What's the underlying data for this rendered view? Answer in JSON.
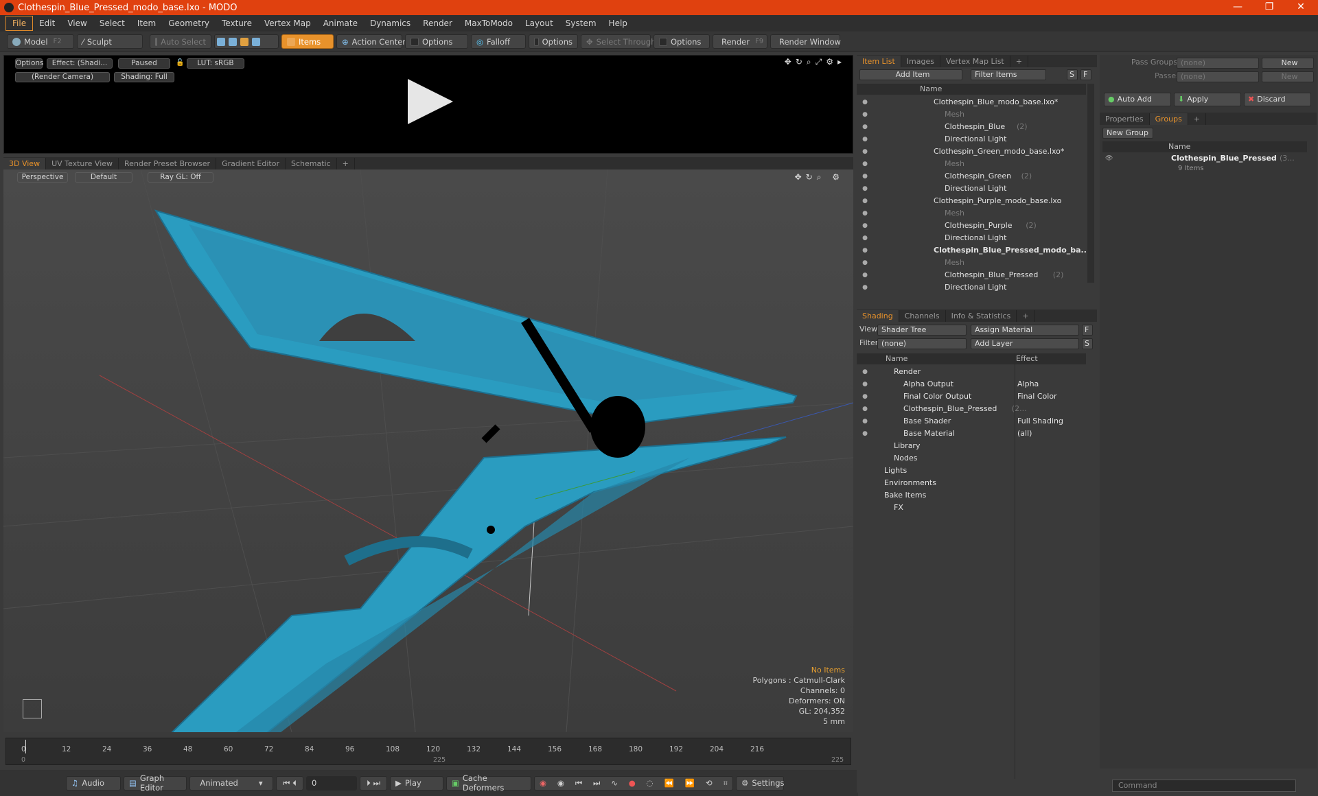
{
  "window": {
    "title": "Clothespin_Blue_Pressed_modo_base.lxo - MODO"
  },
  "menu": [
    "File",
    "Edit",
    "View",
    "Select",
    "Item",
    "Geometry",
    "Texture",
    "Vertex Map",
    "Animate",
    "Dynamics",
    "Render",
    "MaxToModo",
    "Layout",
    "System",
    "Help"
  ],
  "toolbar": {
    "model": "Model",
    "model_key": "F2",
    "sculpt": "Sculpt",
    "auto_select": "Auto Select",
    "items": "Items",
    "action_center": "Action Center",
    "options1": "Options",
    "falloff": "Falloff",
    "options2": "Options",
    "select_through": "Select Through",
    "options3": "Options",
    "render": "Render",
    "render_key": "F9",
    "render_window": "Render Window"
  },
  "preview": {
    "options": "Options",
    "effect": "Effect: (Shadi...",
    "paused": "Paused",
    "lut": "LUT: sRGB",
    "camera": "(Render Camera)",
    "shading": "Shading: Full"
  },
  "viewport_tabs": [
    "3D View",
    "UV Texture View",
    "Render Preset Browser",
    "Gradient Editor",
    "Schematic",
    "+"
  ],
  "viewport": {
    "projection": "Perspective",
    "style": "Default",
    "raygl": "Ray GL: Off"
  },
  "stats": {
    "selection": "No Items",
    "polygons": "Polygons : Catmull-Clark",
    "channels": "Channels: 0",
    "deformers": "Deformers: ON",
    "gl": "GL: 204,352",
    "scale": "5 mm"
  },
  "timeline": {
    "ticks": [
      "0",
      "12",
      "24",
      "36",
      "48",
      "60",
      "72",
      "84",
      "96",
      "108",
      "120",
      "132",
      "144",
      "156",
      "168",
      "180",
      "192",
      "204",
      "216"
    ],
    "sub_ticks": [
      "0",
      "225",
      "225"
    ]
  },
  "bottombar": {
    "audio": "Audio",
    "graph_editor": "Graph Editor",
    "animated": "Animated",
    "frame": "0",
    "play": "Play",
    "cache": "Cache Deformers",
    "settings": "Settings"
  },
  "itemlist": {
    "tabs": [
      "Item List",
      "Images",
      "Vertex Map List",
      "+"
    ],
    "add_item": "Add Item",
    "filter": "Filter Items",
    "s": "S",
    "f": "F",
    "col_name": "Name",
    "rows": [
      {
        "label": "Clothespin_Blue_modo_base.lxo*",
        "indent": 1,
        "kind": "scene",
        "dim": false,
        "count": ""
      },
      {
        "label": "Mesh",
        "indent": 2,
        "kind": "mesh",
        "dim": true,
        "count": ""
      },
      {
        "label": "Clothespin_Blue",
        "indent": 2,
        "kind": "group",
        "dim": false,
        "count": "(2)"
      },
      {
        "label": "Directional Light",
        "indent": 2,
        "kind": "light",
        "dim": false,
        "count": ""
      },
      {
        "label": "Clothespin_Green_modo_base.lxo*",
        "indent": 1,
        "kind": "scene",
        "dim": false,
        "count": ""
      },
      {
        "label": "Mesh",
        "indent": 2,
        "kind": "mesh",
        "dim": true,
        "count": ""
      },
      {
        "label": "Clothespin_Green",
        "indent": 2,
        "kind": "group",
        "dim": false,
        "count": "(2)"
      },
      {
        "label": "Directional Light",
        "indent": 2,
        "kind": "light",
        "dim": false,
        "count": ""
      },
      {
        "label": "Clothespin_Purple_modo_base.lxo",
        "indent": 1,
        "kind": "scene",
        "dim": false,
        "count": ""
      },
      {
        "label": "Mesh",
        "indent": 2,
        "kind": "mesh",
        "dim": true,
        "count": ""
      },
      {
        "label": "Clothespin_Purple",
        "indent": 2,
        "kind": "group",
        "dim": false,
        "count": "(2)"
      },
      {
        "label": "Directional Light",
        "indent": 2,
        "kind": "light",
        "dim": false,
        "count": ""
      },
      {
        "label": "Clothespin_Blue_Pressed_modo_ba...",
        "indent": 1,
        "kind": "scene",
        "dim": false,
        "count": "",
        "bold": true
      },
      {
        "label": "Mesh",
        "indent": 2,
        "kind": "mesh",
        "dim": true,
        "count": ""
      },
      {
        "label": "Clothespin_Blue_Pressed",
        "indent": 2,
        "kind": "group",
        "dim": false,
        "count": "(2)"
      },
      {
        "label": "Directional Light",
        "indent": 2,
        "kind": "light",
        "dim": false,
        "count": ""
      }
    ]
  },
  "shading": {
    "tabs": [
      "Shading",
      "Channels",
      "Info & Statistics",
      "+"
    ],
    "view_label": "View",
    "view_value": "Shader Tree",
    "assign": "Assign Material",
    "f": "F",
    "filter_label": "Filter",
    "filter_value": "(none)",
    "add_layer": "Add Layer",
    "s": "S",
    "col_name": "Name",
    "col_effect": "Effect",
    "rows": [
      {
        "label": "Render",
        "effect": "",
        "indent": 1
      },
      {
        "label": "Alpha Output",
        "effect": "Alpha",
        "indent": 2
      },
      {
        "label": "Final Color Output",
        "effect": "Final Color",
        "indent": 2
      },
      {
        "label": "Clothespin_Blue_Pressed",
        "effect": "",
        "indent": 2,
        "suffix": "(2..."
      },
      {
        "label": "Base Shader",
        "effect": "Full Shading",
        "indent": 2
      },
      {
        "label": "Base Material",
        "effect": "(all)",
        "indent": 2
      },
      {
        "label": "Library",
        "effect": "",
        "indent": 1
      },
      {
        "label": "Nodes",
        "effect": "",
        "indent": 1
      },
      {
        "label": "Lights",
        "effect": "",
        "indent": 0
      },
      {
        "label": "Environments",
        "effect": "",
        "indent": 0
      },
      {
        "label": "Bake Items",
        "effect": "",
        "indent": 0
      },
      {
        "label": "FX",
        "effect": "",
        "indent": 1
      }
    ]
  },
  "groups": {
    "pass_groups": "Pass Groups",
    "pass_value": "(none)",
    "new": "New",
    "passes": "Passes",
    "passes_value": "(none)",
    "new2": "New",
    "auto_add": "Auto Add",
    "apply": "Apply",
    "discard": "Discard",
    "tabs": [
      "Properties",
      "Groups",
      "+"
    ],
    "new_group": "New Group",
    "col_name": "Name",
    "group_name": "Clothespin_Blue_Pressed",
    "group_suffix": "(3...",
    "group_items": "9 Items"
  },
  "command": {
    "placeholder": "Command"
  },
  "colors": {
    "accent": "#e8922b",
    "title": "#e0410f",
    "mesh": "#2a9cc0"
  }
}
